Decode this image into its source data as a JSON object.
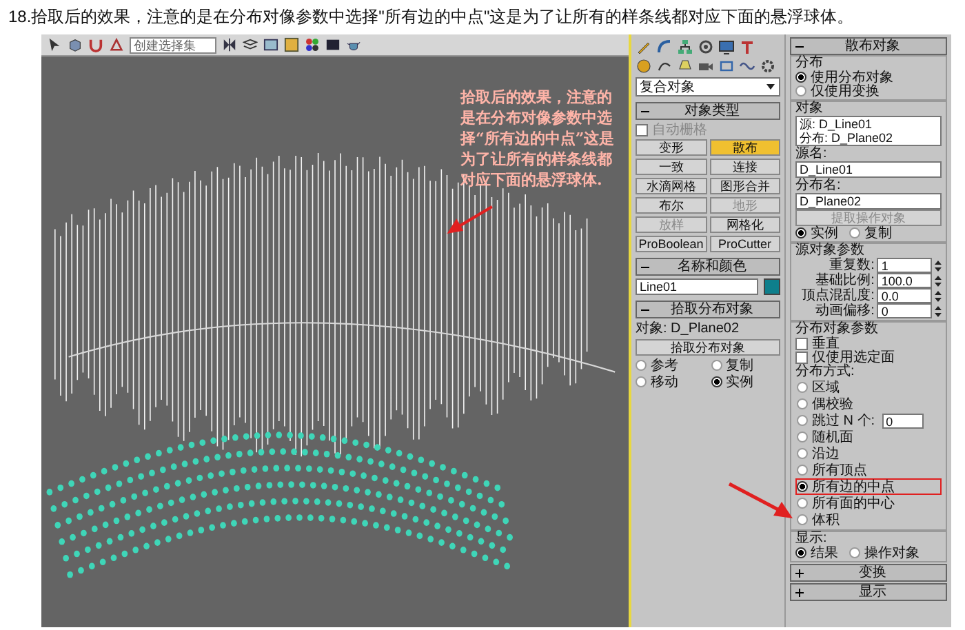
{
  "caption": "18.拾取后的效果，注意的是在分布对像参数中选择\"所有边的中点\"这是为了让所有的样条线都对应下面的悬浮球体。",
  "toolbar": {
    "selection_set": "创建选择集"
  },
  "viewport": {
    "annotation": "拾取后的效果，注意的是在分布对像参数中选择“所有边的中点”这是为了让所有的样条线都对应下面的悬浮球体."
  },
  "create_panel": {
    "category": "复合对象",
    "object_type": {
      "title": "对象类型",
      "expanded": true,
      "autogrid": {
        "label": "自动栅格",
        "checked": false,
        "disabled": true
      },
      "buttons": [
        {
          "label": "变形",
          "selected": false,
          "disabled": false
        },
        {
          "label": "散布",
          "selected": true,
          "disabled": false
        },
        {
          "label": "一致",
          "selected": false,
          "disabled": false
        },
        {
          "label": "连接",
          "selected": false,
          "disabled": false
        },
        {
          "label": "水滴网格",
          "selected": false,
          "disabled": false
        },
        {
          "label": "图形合并",
          "selected": false,
          "disabled": false
        },
        {
          "label": "布尔",
          "selected": false,
          "disabled": false
        },
        {
          "label": "地形",
          "selected": false,
          "disabled": true
        },
        {
          "label": "放样",
          "selected": false,
          "disabled": true
        },
        {
          "label": "网格化",
          "selected": false,
          "disabled": false
        },
        {
          "label": "ProBoolean",
          "selected": false,
          "disabled": false
        },
        {
          "label": "ProCutter",
          "selected": false,
          "disabled": false
        }
      ]
    },
    "name_color": {
      "title": "名称和颜色",
      "expanded": true,
      "name": "Line01",
      "color": "#0e7f8c"
    },
    "pick": {
      "title": "拾取分布对象",
      "expanded": true,
      "object": "对象: D_Plane02",
      "button": "拾取分布对象",
      "options": [
        {
          "label": "参考",
          "selected": false
        },
        {
          "label": "复制",
          "selected": false
        },
        {
          "label": "移动",
          "selected": false
        },
        {
          "label": "实例",
          "selected": true
        }
      ]
    }
  },
  "scatter_panel": {
    "scatter": {
      "title": "散布对象",
      "expanded": true,
      "group": "分布",
      "options": [
        {
          "label": "使用分布对象",
          "selected": true
        },
        {
          "label": "仅使用变换",
          "selected": false
        }
      ],
      "objects_group": "对象",
      "list": [
        "源: D_Line01",
        "分布: D_Plane02"
      ],
      "source_label": "源名:",
      "source_name": "D_Line01",
      "dist_label": "分布名:",
      "dist_name": "D_Plane02",
      "extract": {
        "label": "提取操作对象",
        "disabled": true
      },
      "modes": [
        {
          "label": "实例",
          "selected": true
        },
        {
          "label": "复制",
          "selected": false
        }
      ]
    },
    "source_params": {
      "title": "源对象参数",
      "fields": [
        {
          "label": "重复数:",
          "value": "1"
        },
        {
          "label": "基础比例:",
          "value": "100.0"
        },
        {
          "label": "顶点混乱度:",
          "value": "0.0"
        },
        {
          "label": "动画偏移:",
          "value": "0"
        }
      ]
    },
    "dist_params": {
      "title": "分布对象参数",
      "checks": [
        {
          "label": "垂直",
          "checked": false
        },
        {
          "label": "仅使用选定面",
          "checked": false
        }
      ],
      "method_label": "分布方式:",
      "methods": [
        {
          "label": "区域",
          "selected": false,
          "highlighted": false
        },
        {
          "label": "偶校验",
          "selected": false,
          "highlighted": false
        },
        {
          "label": "跳过 N 个:",
          "selected": false,
          "highlighted": false,
          "value": "0"
        },
        {
          "label": "随机面",
          "selected": false,
          "highlighted": false
        },
        {
          "label": "沿边",
          "selected": false,
          "highlighted": false
        },
        {
          "label": "所有顶点",
          "selected": false,
          "highlighted": false
        },
        {
          "label": "所有边的中点",
          "selected": true,
          "highlighted": true
        },
        {
          "label": "所有面的中心",
          "selected": false,
          "highlighted": false
        },
        {
          "label": "体积",
          "selected": false,
          "highlighted": false
        }
      ]
    },
    "display": {
      "title": "显示:",
      "options": [
        {
          "label": "结果",
          "selected": true
        },
        {
          "label": "操作对象",
          "selected": false
        }
      ]
    },
    "collapsed": [
      {
        "title": "变换",
        "expanded": false
      },
      {
        "title": "显示",
        "expanded": false
      }
    ]
  }
}
